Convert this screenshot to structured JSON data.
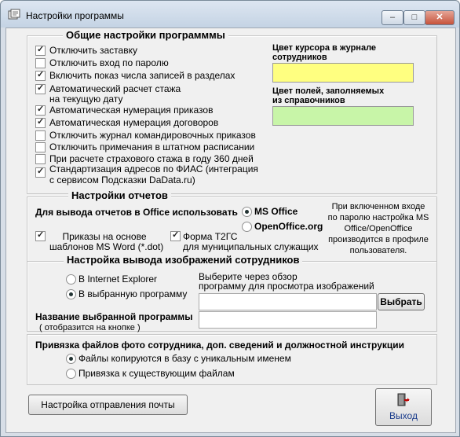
{
  "window": {
    "title": "Настройки программы",
    "minimize": "‒",
    "maximize": "□",
    "close": "✕"
  },
  "general": {
    "title": "Общие настройки программмы",
    "options": [
      {
        "label": "Отключить заставку",
        "checked": true
      },
      {
        "label": "Отключить вход по паролю",
        "checked": false
      },
      {
        "label": "Включить показ числа записей в разделах",
        "checked": true
      },
      {
        "label": "Автоматический расчет стажа",
        "label2": "на текущую дату",
        "checked": true
      },
      {
        "label": "Автоматическая нумерация приказов",
        "checked": true
      },
      {
        "label": "Автоматическая нумерация договоров",
        "checked": true
      },
      {
        "label": "Отключить журнал командировочных приказов",
        "checked": false
      },
      {
        "label": "Отключить примечания в штатном расписании",
        "checked": false
      },
      {
        "label": "При расчете страхового стажа в году 360 дней",
        "checked": false
      },
      {
        "label": "Стандартизация адресов по ФИАС (интеграция",
        "label2": "с сервисом Подсказки DaData.ru)",
        "checked": true
      }
    ],
    "cursor_color_label1": "Цвет курсора в журнале",
    "cursor_color_label2": "сотрудников",
    "cursor_color": "#ffff80",
    "fields_color_label1": "Цвет полей, заполняемых",
    "fields_color_label2": "из справочников",
    "fields_color": "#c8f5a8"
  },
  "reports": {
    "title": "Настройки отчетов",
    "office_label": "Для вывода отчетов в Office использовать",
    "ms_office": "MS Office",
    "open_office": "OpenOffice.org",
    "note": [
      "При включенном входе",
      "по паролю настройка MS",
      "Office/OpenOffice",
      "производится в профиле",
      "пользователя."
    ],
    "orders_label1": "Приказы на основе",
    "orders_label2": "шаблонов MS Word (*.dot)",
    "t2gs_label1": "Форма Т2ГС",
    "t2gs_label2": "для муниципальных служащих"
  },
  "images": {
    "title": "Настройка вывода изображений сотрудников",
    "ie": "В Internet Explorer",
    "selected_program": "В выбранную программу",
    "browse_hint1": "Выберите через обзор",
    "browse_hint2": "программу для просмотра изображений",
    "browse_button": "Выбрать",
    "program_name_label": "Название выбранной программы",
    "program_name_hint": "( отобразится на кнопке )",
    "program_path": "",
    "program_name": ""
  },
  "files": {
    "title": "Привязка файлов фото сотрудника, доп. сведений и должностной инструкции",
    "copy_option": "Файлы копируются в базу с уникальным именем",
    "link_option": "Привязка к существующим файлам"
  },
  "footer": {
    "mail_button": "Настройка отправления почты",
    "exit_button": "Выход"
  }
}
